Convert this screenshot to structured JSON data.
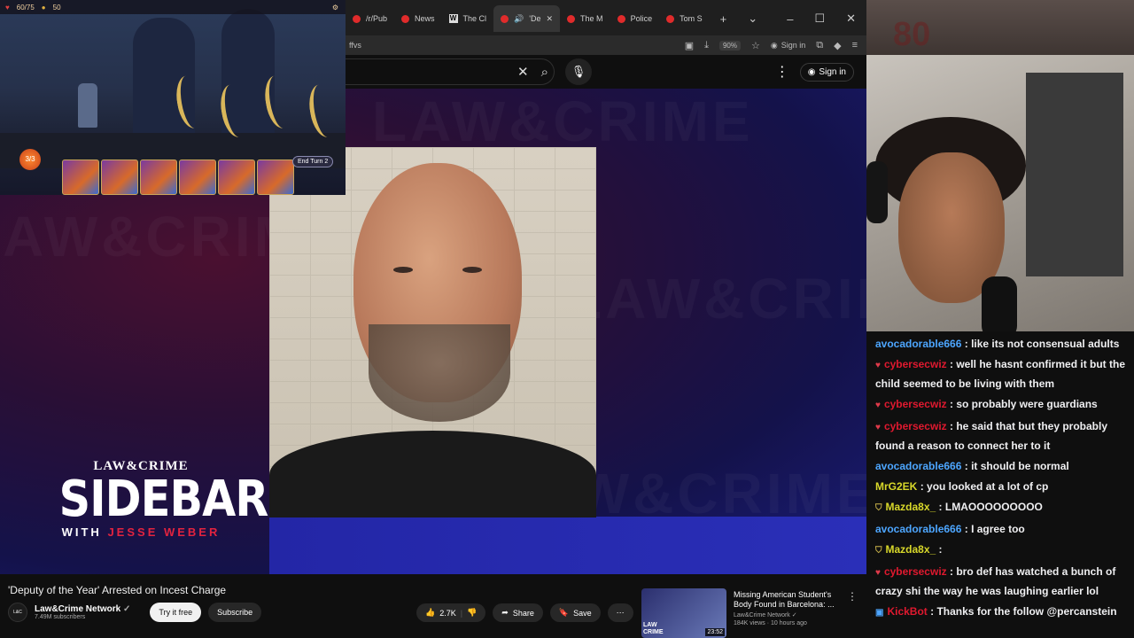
{
  "game": {
    "hud_hp": "60/75",
    "hud_gold": "50",
    "end_turn": "End Turn 2",
    "energy": "3/3"
  },
  "browser": {
    "tabs": [
      {
        "label": "/r/Pub",
        "icon": "reddit-icon"
      },
      {
        "label": "News",
        "icon": "news-icon"
      },
      {
        "label": "The Cl",
        "icon": "wikipedia-icon"
      },
      {
        "label": "'De",
        "icon": "youtube-icon",
        "active": true
      },
      {
        "label": "The M",
        "icon": "youtube-icon"
      },
      {
        "label": "Police",
        "icon": "youtube-icon"
      },
      {
        "label": "Tom S",
        "icon": "youtube-icon"
      }
    ],
    "url_fragment": "ffvs",
    "zoom": "90%",
    "signin": "Sign in"
  },
  "youtube": {
    "signin": "Sign in",
    "video": {
      "title": "'Deputy of the Year' Arrested on Incest Charge",
      "channel": "Law&Crime Network",
      "subscribers": "7.49M subscribers",
      "try_label": "Try it free",
      "subscribe_label": "Subscribe",
      "likes": "2.7K",
      "share_label": "Share",
      "save_label": "Save"
    },
    "overlay": {
      "brand": "LAW&CRIME",
      "show": "SIDEBAR",
      "with": "WITH",
      "host": "JESSE WEBER"
    },
    "recommended": {
      "title": "Missing American Student's Body Found in Barcelona: ...",
      "channel": "Law&Crime Network",
      "meta": "184K views · 10 hours ago",
      "duration": "23:52"
    }
  },
  "chat": {
    "messages": [
      {
        "user": "avocadorable666",
        "text": ": like its not consensual adults",
        "color": "#4da6ff",
        "badge": ""
      },
      {
        "user": "cybersecwiz",
        "text": ": well he hasnt confirmed it but the child seemed to be living with them",
        "color": "#e0192f",
        "badge": "heart"
      },
      {
        "user": "cybersecwiz",
        "text": ": so probably were guardians",
        "color": "#e0192f",
        "badge": "heart"
      },
      {
        "user": "cybersecwiz",
        "text": ": he said that but they probably found a reason to connect her to it",
        "color": "#e0192f",
        "badge": "heart"
      },
      {
        "user": "avocadorable666",
        "text": ": it should be normal",
        "color": "#4da6ff",
        "badge": ""
      },
      {
        "user": "MrG2EK",
        "text": ": you looked at a lot of cp",
        "color": "#d8d82a",
        "badge": ""
      },
      {
        "user": "Mazda8x_",
        "text": ": LMAOOOOOOOOO",
        "color": "#d8d82a",
        "badge": "shield"
      },
      {
        "user": "avocadorable666",
        "text": ": I agree too",
        "color": "#4da6ff",
        "badge": ""
      },
      {
        "user": "Mazda8x_",
        "text": ":",
        "color": "#d8d82a",
        "badge": "shield"
      },
      {
        "user": "cybersecwiz",
        "text": ": bro def has watched a bunch of crazy shi the way he was laughing earlier lol",
        "color": "#e0192f",
        "badge": "heart"
      },
      {
        "user": "KickBot",
        "text": ": Thanks for the follow @percanstein",
        "color": "#e0192f",
        "badge": "bot"
      }
    ]
  }
}
